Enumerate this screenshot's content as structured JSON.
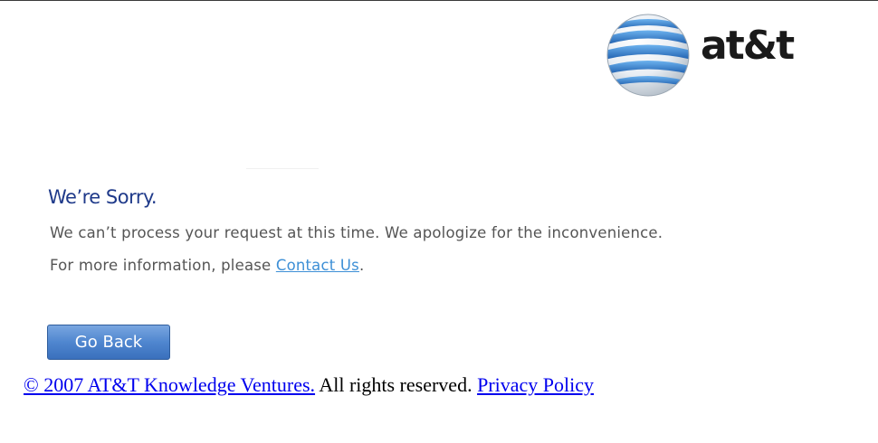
{
  "logo": {
    "text": "at&t",
    "globe_colors": [
      "#1f5fae",
      "#5fa8e8",
      "#ffffff"
    ]
  },
  "error": {
    "heading": "We’re Sorry.",
    "message": "We can’t process your request at this time. We apologize for the inconvenience.",
    "more_info_prefix": "For more information, please ",
    "contact_link": "Contact Us",
    "more_info_suffix": "."
  },
  "actions": {
    "go_back_label": "Go Back"
  },
  "footer": {
    "copyright_link": "© 2007 AT&T Knowledge Ventures.",
    "rights_text": " All rights reserved. ",
    "privacy_link": "Privacy Policy"
  },
  "colors": {
    "heading": "#1f3a8a",
    "body_text": "#555555",
    "link": "#3d8fd6",
    "button": "#4f86cf",
    "footer_link": "#0000ee"
  }
}
